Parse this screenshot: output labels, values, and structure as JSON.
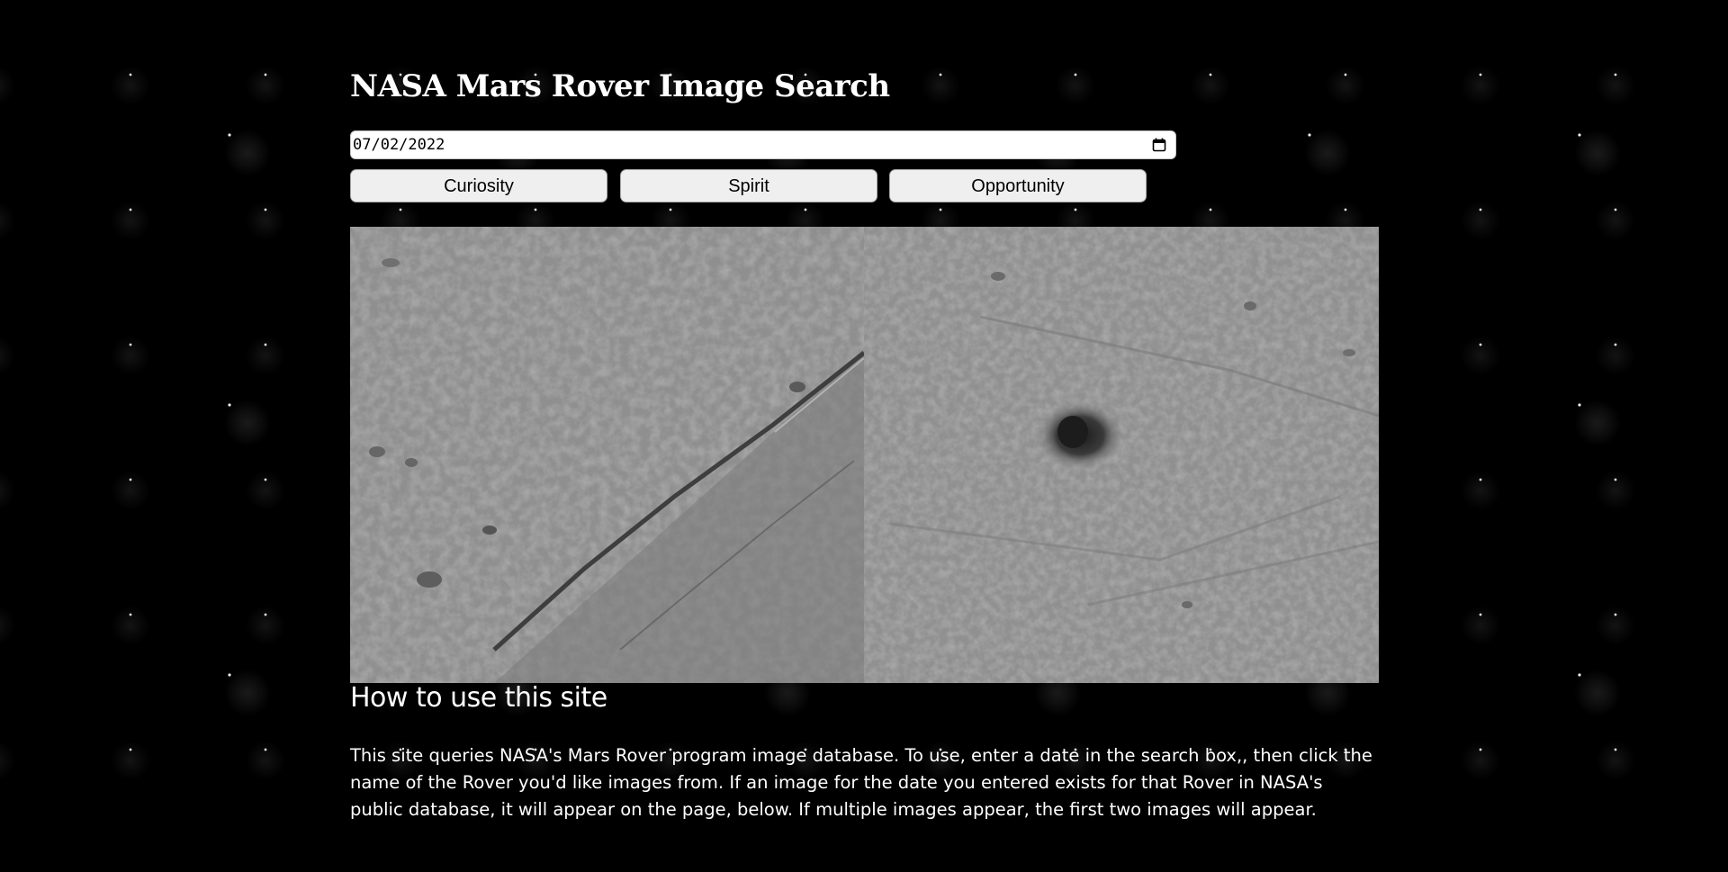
{
  "page": {
    "title": "NASA Mars Rover Image Search"
  },
  "search": {
    "date_value": "07/02/2022",
    "calendar_icon": "calendar-icon"
  },
  "rovers": {
    "buttons": [
      {
        "label": "Curiosity"
      },
      {
        "label": "Spirit"
      },
      {
        "label": "Opportunity"
      }
    ]
  },
  "results": {
    "image_count": 2
  },
  "help": {
    "title": "How to use this site",
    "text": "This site queries NASA's Mars Rover program image database. To use, enter a date in the search box,, then click the name of the Rover you'd like images from. If an image for the date you entered exists for that Rover in NASA's public database, it will appear on the page, below. If multiple images appear, the first two images will appear."
  },
  "colors": {
    "background": "#000000",
    "text": "#ffffff",
    "button_bg": "#efefef",
    "input_bg": "#ffffff"
  }
}
